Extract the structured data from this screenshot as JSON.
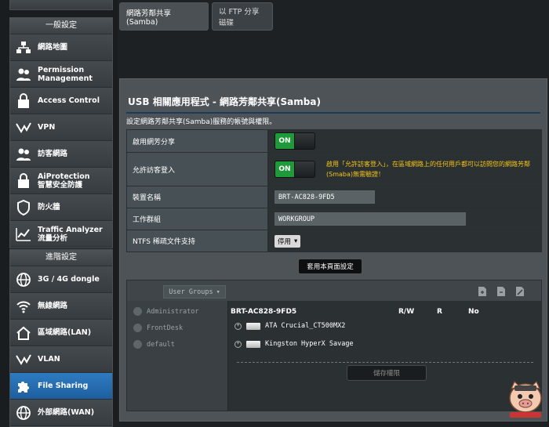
{
  "sidebar": {
    "general_title": "一般設定",
    "general_items": [
      {
        "label": "網路地圖",
        "icon": "network-map-icon"
      },
      {
        "label": "Permission\nManagement",
        "icon": "users-icon"
      },
      {
        "label": "Access Control",
        "icon": "lock-icon"
      },
      {
        "label": "VPN",
        "icon": "vpn-icon"
      },
      {
        "label": "訪客網路",
        "icon": "guest-network-icon"
      },
      {
        "label": "AiProtection\n智慧安全防護",
        "icon": "lock-icon"
      },
      {
        "label": "防火牆",
        "icon": "shield-icon"
      },
      {
        "label": "Traffic Analyzer\n流量分析",
        "icon": "traffic-chart-icon"
      }
    ],
    "advanced_title": "進階設定",
    "advanced_items": [
      {
        "label": "3G / 4G dongle",
        "icon": "globe-icon"
      },
      {
        "label": "無線網路",
        "icon": "wifi-icon"
      },
      {
        "label": "區域網路(LAN)",
        "icon": "home-icon"
      },
      {
        "label": "VLAN",
        "icon": "vpn-icon"
      },
      {
        "label": "File Sharing",
        "icon": "puzzle-icon",
        "active": true
      },
      {
        "label": "外部網路(WAN)",
        "icon": "globe-icon"
      }
    ]
  },
  "tabs": [
    {
      "label": "網路芳鄰共享(Samba)",
      "active": true
    },
    {
      "label": "以 FTP 分享磁碟",
      "active": false
    }
  ],
  "panel": {
    "title": "USB 相關應用程式 - 網路芳鄰共享(Samba)",
    "description": "設定網路芳鄰共享(Samba)服務的帳號與權限。",
    "rows": {
      "enable_label": "啟用網芳分享",
      "enable_value": "ON",
      "guest_label": "允許訪客登入",
      "guest_value": "ON",
      "guest_hint": "啟用「允許訪客登入」，在區域網路上的任何用戶都可以訪問您的網路芳鄰(Smaba)無需驗證！",
      "device_label": "裝置名稱",
      "device_value": "BRT-AC828-9FD5",
      "workgroup_label": "工作群組",
      "workgroup_value": "WORKGROUP",
      "ntfs_label": "NTFS 稀疏文件支持",
      "ntfs_value": "停用"
    },
    "apply_label": "套用本頁面設定"
  },
  "share": {
    "user_groups_label": "User Groups",
    "users": [
      "Administrator",
      "FrontDesk",
      "default"
    ],
    "device_name": "BRT-AC828-9FD5",
    "perm_rw": "R/W",
    "perm_r": "R",
    "perm_no": "No",
    "disks": [
      "ATA Crucial_CT500MX2",
      "Kingston HyperX Savage"
    ],
    "save_label": "儲存權限"
  },
  "colors": {
    "active_item": "#2f7bc0",
    "toggle_on": "#1f9a3b",
    "hint": "#f5c518"
  }
}
